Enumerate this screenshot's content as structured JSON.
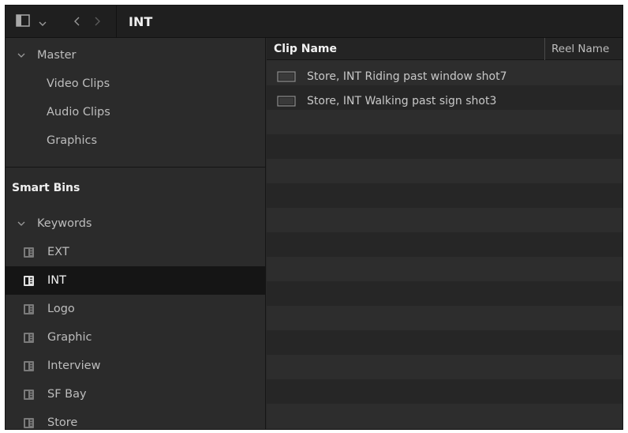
{
  "toolbar": {
    "title": "INT",
    "icons": [
      "sidebar-panel-icon",
      "chevron-down-icon",
      "back-arrow-icon",
      "forward-arrow-icon"
    ]
  },
  "sidebar": {
    "master": {
      "label": "Master",
      "items": [
        "Video Clips",
        "Audio Clips",
        "Graphics"
      ]
    },
    "smart_bins_label": "Smart Bins",
    "keywords": {
      "label": "Keywords",
      "bins": [
        {
          "label": "EXT",
          "selected": false
        },
        {
          "label": "INT",
          "selected": true
        },
        {
          "label": "Logo",
          "selected": false
        },
        {
          "label": "Graphic",
          "selected": false
        },
        {
          "label": "Interview",
          "selected": false
        },
        {
          "label": "SF Bay",
          "selected": false
        },
        {
          "label": "Store",
          "selected": false
        }
      ]
    }
  },
  "clip_list": {
    "columns": [
      "Clip Name",
      "Reel Name"
    ],
    "clips": [
      {
        "name": "Store, INT Riding past window shot7",
        "reel": ""
      },
      {
        "name": "Store, INT Walking past sign shot3",
        "reel": ""
      }
    ]
  },
  "colors": {
    "selected_row": "#151515",
    "panel_bg": "#2b2b2b"
  }
}
